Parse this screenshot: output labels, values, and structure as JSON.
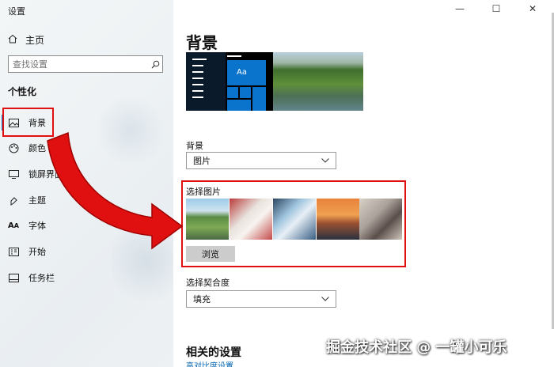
{
  "window": {
    "title": "设置",
    "controls": {
      "minimize": "—",
      "maximize": "☐",
      "close": "✕"
    }
  },
  "sidebar": {
    "home_label": "主页",
    "search": {
      "placeholder": "查找设置"
    },
    "section_title": "个性化",
    "items": [
      {
        "label": "背景",
        "icon": "picture-icon",
        "active": true
      },
      {
        "label": "颜色",
        "icon": "palette-icon"
      },
      {
        "label": "锁屏界面",
        "icon": "lock-screen-icon"
      },
      {
        "label": "主题",
        "icon": "brush-icon"
      },
      {
        "label": "字体",
        "icon": "font-icon"
      },
      {
        "label": "开始",
        "icon": "start-icon"
      },
      {
        "label": "任务栏",
        "icon": "taskbar-icon"
      }
    ]
  },
  "main": {
    "title": "背景",
    "preview": {
      "tile_text": "Aa"
    },
    "background": {
      "label": "背景",
      "value": "图片"
    },
    "choose_picture": {
      "label": "选择图片",
      "browse_label": "浏览"
    },
    "fit": {
      "label": "选择契合度",
      "value": "填充"
    },
    "related": {
      "title": "相关的设置",
      "link": "高对比度设置"
    }
  },
  "watermark": "掘金技术社区 @ 一罐小可乐",
  "colors": {
    "accent": "#0078d7",
    "highlight_red": "#e01010"
  }
}
